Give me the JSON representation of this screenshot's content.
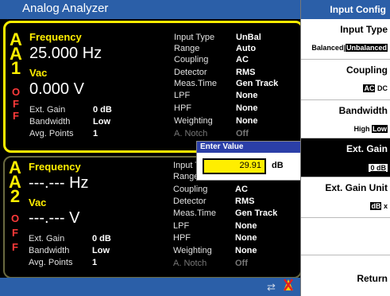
{
  "app_title": "Analog Analyzer",
  "panel_a": {
    "channel_letters": [
      "A",
      "A",
      "1"
    ],
    "off_letters": [
      "O",
      "F",
      "F"
    ],
    "frequency_label": "Frequency",
    "frequency_value": "25.000 Hz",
    "voltage_label": "Vac",
    "voltage_value": "0.000 V",
    "ext_gain_label": "Ext. Gain",
    "ext_gain_value": "0 dB",
    "bandwidth_label": "Bandwidth",
    "bandwidth_value": "Low",
    "avg_points_label": "Avg. Points",
    "avg_points_value": "1",
    "settings": [
      {
        "label": "Input Type",
        "value": "UnBal"
      },
      {
        "label": "Range",
        "value": "Auto"
      },
      {
        "label": "Coupling",
        "value": "AC"
      },
      {
        "label": "Detector",
        "value": "RMS"
      },
      {
        "label": "Meas.Time",
        "value": "Gen Track"
      },
      {
        "label": "LPF",
        "value": "None"
      },
      {
        "label": "HPF",
        "value": "None"
      },
      {
        "label": "Weighting",
        "value": "None"
      },
      {
        "label": "A. Notch",
        "value": "Off"
      }
    ]
  },
  "panel_b": {
    "channel_letters": [
      "A",
      "A",
      "2"
    ],
    "off_letters": [
      "O",
      "F",
      "F"
    ],
    "frequency_label": "Frequency",
    "frequency_value": "---.--- Hz",
    "voltage_label": "Vac",
    "voltage_value": "---.--- V",
    "ext_gain_label": "Ext. Gain",
    "ext_gain_value": "0 dB",
    "bandwidth_label": "Bandwidth",
    "bandwidth_value": "Low",
    "avg_points_label": "Avg. Points",
    "avg_points_value": "1",
    "settings": [
      {
        "label": "Input Type",
        "value": ""
      },
      {
        "label": "Range",
        "value": ""
      },
      {
        "label": "Coupling",
        "value": "AC"
      },
      {
        "label": "Detector",
        "value": "RMS"
      },
      {
        "label": "Meas.Time",
        "value": "Gen Track"
      },
      {
        "label": "LPF",
        "value": "None"
      },
      {
        "label": "HPF",
        "value": "None"
      },
      {
        "label": "Weighting",
        "value": "None"
      },
      {
        "label": "A. Notch",
        "value": "Off"
      }
    ]
  },
  "dialog": {
    "title": "Enter Value",
    "value": "29.91",
    "unit": "dB"
  },
  "sidebar": {
    "title": "Input Config",
    "input_type": {
      "label": "Input Type",
      "opt1": "Balanced",
      "sep": "|",
      "opt2": "Unbalanced"
    },
    "coupling": {
      "label": "Coupling",
      "opt1": "AC",
      "opt2": "DC"
    },
    "bandwidth": {
      "label": "Bandwidth",
      "opt1": "High",
      "opt2": "Low"
    },
    "ext_gain": {
      "label": "Ext. Gain",
      "value": "0 dB"
    },
    "ext_gain_unit": {
      "label": "Ext. Gain Unit",
      "opt1": "dB",
      "opt2": "x"
    },
    "return_label": "Return"
  },
  "colors": {
    "accent": "#2b5fa8",
    "highlight": "#ffee00",
    "off": "#ff3a3a"
  }
}
